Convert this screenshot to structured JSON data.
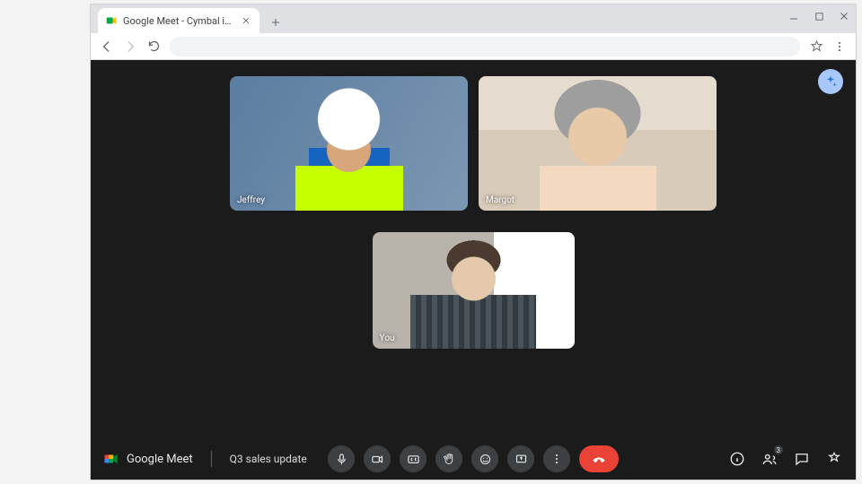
{
  "browser": {
    "tab_title": "Google Meet - Cymbal intro"
  },
  "meet": {
    "brand": "Google Meet",
    "meeting_name": "Q3 sales update",
    "participants": [
      {
        "label": "Jeffrey"
      },
      {
        "label": "Margot"
      },
      {
        "label": "You"
      }
    ],
    "people_count": "3"
  },
  "icons": {
    "mic": "mic-icon",
    "camera": "camera-icon",
    "captions": "captions-icon",
    "raise_hand": "raise-hand-icon",
    "reactions": "emoji-icon",
    "present": "present-icon",
    "more": "more-icon",
    "hangup": "hangup-icon",
    "info": "info-icon",
    "people": "people-icon",
    "chat": "chat-icon",
    "activities": "activities-icon",
    "ai": "sparkle-icon"
  }
}
